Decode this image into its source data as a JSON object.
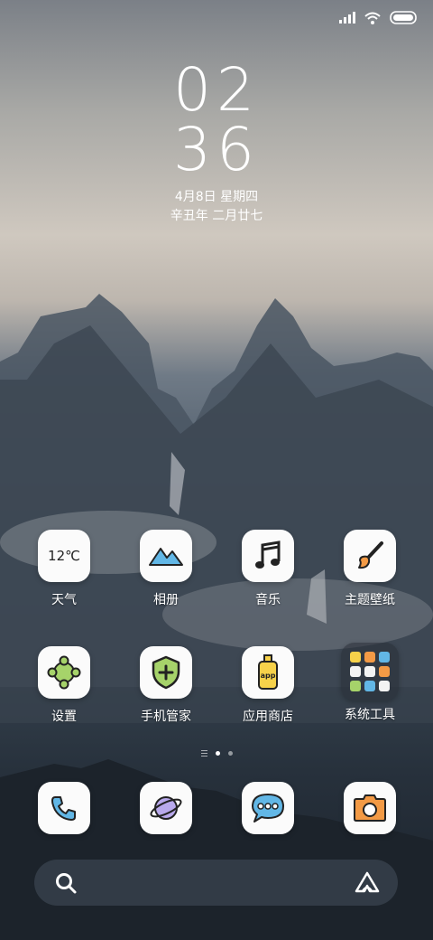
{
  "status_bar": {
    "signal": "signal-icon",
    "wifi": "wifi-icon",
    "battery": "battery-icon"
  },
  "clock": {
    "hour": "02",
    "minute": "36"
  },
  "date": {
    "solar": "4月8日 星期四",
    "lunar": "辛丑年 二月廿七"
  },
  "apps_row1": [
    {
      "label": "天气",
      "icon": "weather-icon",
      "temp": "12℃"
    },
    {
      "label": "相册",
      "icon": "gallery-icon"
    },
    {
      "label": "音乐",
      "icon": "music-icon"
    },
    {
      "label": "主题壁纸",
      "icon": "theme-brush-icon"
    }
  ],
  "apps_row2": [
    {
      "label": "设置",
      "icon": "settings-icon"
    },
    {
      "label": "手机管家",
      "icon": "security-shield-icon"
    },
    {
      "label": "应用商店",
      "icon": "app-store-icon",
      "badge_text": "app"
    },
    {
      "label": "系统工具",
      "icon": "folder-icon"
    }
  ],
  "page_indicator": {
    "pages": 2,
    "active": 1
  },
  "dock": [
    {
      "icon": "phone-icon"
    },
    {
      "icon": "browser-planet-icon"
    },
    {
      "icon": "messages-icon"
    },
    {
      "icon": "camera-icon"
    }
  ],
  "search_bar": {
    "left_icon": "search-icon",
    "right_icon": "assistant-icon"
  },
  "colors": {
    "accent_blue": "#62b7e6",
    "accent_yellow": "#f7d24a",
    "accent_green": "#a6d36a",
    "accent_orange": "#f39a45",
    "accent_purple": "#b9a9ec",
    "line": "#222222"
  }
}
